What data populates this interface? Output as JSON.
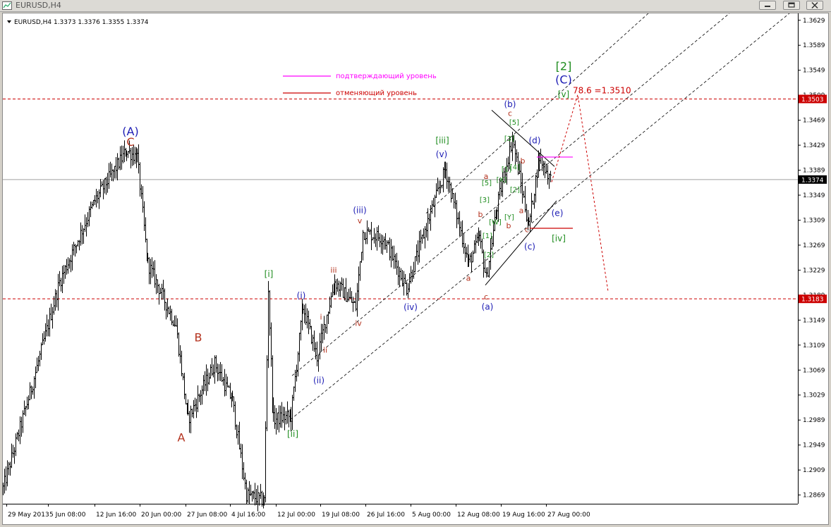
{
  "window": {
    "title": "EURUSD,H4",
    "icon": "chart-window-icon",
    "controls": [
      "minimize-icon",
      "restore-icon",
      "close-icon"
    ]
  },
  "header": {
    "symbol_line": "EURUSD,H4  1.3373 1.3376 1.3355 1.3374"
  },
  "legend": [
    {
      "label": "подтверждающий уровень",
      "color": "#ff00ff"
    },
    {
      "label": "отменяющий уровень",
      "color": "#cc0000"
    }
  ],
  "colors": {
    "background": "#ffffff",
    "bars": "#000000",
    "grid": "#c0c0c0",
    "level_line": "#cc0000",
    "channel": "#000000",
    "wave_blue": "#1c1cb4",
    "wave_green": "#1e8c1e",
    "wave_red": "#b4321e"
  },
  "chart_data": {
    "type": "ohlc",
    "symbol": "EURUSD",
    "timeframe": "H4",
    "last": {
      "open": 1.3373,
      "high": 1.3376,
      "low": 1.3355,
      "close": 1.3374
    },
    "ylim": [
      1.2855,
      1.364
    ],
    "y_ticks": [
      1.3629,
      1.3589,
      1.3549,
      1.3509,
      1.3469,
      1.3429,
      1.3389,
      1.3349,
      1.3309,
      1.3269,
      1.3229,
      1.3189,
      1.3149,
      1.3109,
      1.3069,
      1.3029,
      1.2989,
      1.2949,
      1.2909,
      1.2869
    ],
    "x_ticks": [
      "29 May 2013",
      "5 Jun 08:00",
      "12 Jun 16:00",
      "20 Jun 00:00",
      "27 Jun 08:00",
      "4 Jul 16:00",
      "12 Jul 00:00",
      "19 Jul 08:00",
      "26 Jul 16:00",
      "5 Aug 00:00",
      "12 Aug 08:00",
      "19 Aug 16:00",
      "27 Aug 00:00"
    ],
    "price_flags": [
      {
        "value": 1.3503,
        "label": "1.3503",
        "color": "#cc0000"
      },
      {
        "value": 1.3374,
        "label": "1.3374",
        "color": "#000000"
      },
      {
        "value": 1.3183,
        "label": "1.3183",
        "color": "#cc0000"
      }
    ],
    "horizontal_levels": [
      {
        "value": 1.3503,
        "style": "dashed",
        "color": "#cc0000"
      },
      {
        "value": 1.3183,
        "style": "dashed",
        "color": "#cc0000"
      },
      {
        "value": 1.3374,
        "style": "solid",
        "color": "#a0a0a0"
      }
    ],
    "fib_annotation": "78.6 =1.3510",
    "anchors": [
      {
        "t": 0,
        "p": 1.288
      },
      {
        "t": 40,
        "p": 1.304
      },
      {
        "t": 80,
        "p": 1.321
      },
      {
        "t": 130,
        "p": 1.334
      },
      {
        "t": 175,
        "p": 1.342
      },
      {
        "t": 190,
        "p": 1.341
      },
      {
        "t": 205,
        "p": 1.324
      },
      {
        "t": 245,
        "p": 1.314
      },
      {
        "t": 262,
        "p": 1.299
      },
      {
        "t": 300,
        "p": 1.308
      },
      {
        "t": 325,
        "p": 1.302
      },
      {
        "t": 345,
        "p": 1.287
      },
      {
        "t": 370,
        "p": 1.286
      },
      {
        "t": 376,
        "p": 1.32
      },
      {
        "t": 383,
        "p": 1.299
      },
      {
        "t": 408,
        "p": 1.2995
      },
      {
        "t": 425,
        "p": 1.317
      },
      {
        "t": 445,
        "p": 1.309
      },
      {
        "t": 470,
        "p": 1.321
      },
      {
        "t": 500,
        "p": 1.317
      },
      {
        "t": 510,
        "p": 1.329
      },
      {
        "t": 540,
        "p": 1.328
      },
      {
        "t": 572,
        "p": 1.32
      },
      {
        "t": 600,
        "p": 1.33
      },
      {
        "t": 627,
        "p": 1.339
      },
      {
        "t": 660,
        "p": 1.324
      },
      {
        "t": 675,
        "p": 1.328
      },
      {
        "t": 685,
        "p": 1.3215
      },
      {
        "t": 700,
        "p": 1.333
      },
      {
        "t": 722,
        "p": 1.344
      },
      {
        "t": 745,
        "p": 1.33
      },
      {
        "t": 760,
        "p": 1.341
      },
      {
        "t": 778,
        "p": 1.337
      }
    ],
    "wave_labels": [
      {
        "text": "(A)",
        "t": 181,
        "p": 1.3445,
        "color": "blue",
        "size": 16
      },
      {
        "text": "C",
        "t": 181,
        "p": 1.3428,
        "color": "red",
        "size": 16
      },
      {
        "text": "B",
        "t": 277,
        "p": 1.3115,
        "color": "red",
        "size": 16
      },
      {
        "text": "A",
        "t": 253,
        "p": 1.2955,
        "color": "red",
        "size": 16
      },
      {
        "text": "[i]",
        "t": 377,
        "p": 1.3218,
        "color": "green",
        "size": 12
      },
      {
        "text": "[ii]",
        "t": 411,
        "p": 1.2962,
        "color": "green",
        "size": 12
      },
      {
        "text": "(i)",
        "t": 423,
        "p": 1.3184,
        "color": "blue",
        "size": 12
      },
      {
        "text": "(ii)",
        "t": 448,
        "p": 1.3048,
        "color": "blue",
        "size": 12
      },
      {
        "text": "i",
        "t": 451,
        "p": 1.315,
        "color": "red",
        "size": 11
      },
      {
        "text": "ii",
        "t": 457,
        "p": 1.3097,
        "color": "red",
        "size": 11
      },
      {
        "text": "iii",
        "t": 469,
        "p": 1.3225,
        "color": "red",
        "size": 11
      },
      {
        "text": "iv",
        "t": 504,
        "p": 1.314,
        "color": "red",
        "size": 11
      },
      {
        "text": "v",
        "t": 506,
        "p": 1.3304,
        "color": "red",
        "size": 11
      },
      {
        "text": "(iii)",
        "t": 506,
        "p": 1.332,
        "color": "blue",
        "size": 12
      },
      {
        "text": "(iv)",
        "t": 578,
        "p": 1.3165,
        "color": "blue",
        "size": 12
      },
      {
        "text": "(v)",
        "t": 622,
        "p": 1.341,
        "color": "blue",
        "size": 12
      },
      {
        "text": "[iii]",
        "t": 623,
        "p": 1.3432,
        "color": "green",
        "size": 12
      },
      {
        "text": "a",
        "t": 660,
        "p": 1.3212,
        "color": "red",
        "size": 11
      },
      {
        "text": "c",
        "t": 685,
        "p": 1.3182,
        "color": "red",
        "size": 11
      },
      {
        "text": "(a)",
        "t": 687,
        "p": 1.3166,
        "color": "blue",
        "size": 12
      },
      {
        "text": "b",
        "t": 677,
        "p": 1.3314,
        "color": "red",
        "size": 11
      },
      {
        "text": "a",
        "t": 685,
        "p": 1.3375,
        "color": "red",
        "size": 11
      },
      {
        "text": "[5]",
        "t": 686,
        "p": 1.3365,
        "color": "green",
        "size": 10
      },
      {
        "text": "[3]",
        "t": 683,
        "p": 1.3338,
        "color": "green",
        "size": 10
      },
      {
        "text": "[1]",
        "t": 687,
        "p": 1.328,
        "color": "green",
        "size": 10
      },
      {
        "text": "[2]",
        "t": 689,
        "p": 1.325,
        "color": "green",
        "size": 10
      },
      {
        "text": "[W]",
        "t": 698,
        "p": 1.3302,
        "color": "green",
        "size": 10
      },
      {
        "text": "[X]",
        "t": 707,
        "p": 1.337,
        "color": "green",
        "size": 10
      },
      {
        "text": "[Y]",
        "t": 718,
        "p": 1.331,
        "color": "green",
        "size": 10
      },
      {
        "text": "b",
        "t": 717,
        "p": 1.3296,
        "color": "red",
        "size": 11
      },
      {
        "text": "(b)",
        "t": 719,
        "p": 1.349,
        "color": "blue",
        "size": 12
      },
      {
        "text": "c",
        "t": 719,
        "p": 1.3476,
        "color": "red",
        "size": 11
      },
      {
        "text": "[5]",
        "t": 725,
        "p": 1.3462,
        "color": "green",
        "size": 10
      },
      {
        "text": "[3]",
        "t": 718,
        "p": 1.3436,
        "color": "green",
        "size": 10
      },
      {
        "text": "[1]",
        "t": 714,
        "p": 1.3387,
        "color": "green",
        "size": 10
      },
      {
        "text": "[4]",
        "t": 726,
        "p": 1.339,
        "color": "green",
        "size": 10
      },
      {
        "text": "[2]",
        "t": 726,
        "p": 1.3354,
        "color": "green",
        "size": 10
      },
      {
        "text": "b",
        "t": 737,
        "p": 1.34,
        "color": "red",
        "size": 11
      },
      {
        "text": "a",
        "t": 735,
        "p": 1.332,
        "color": "red",
        "size": 11
      },
      {
        "text": "c",
        "t": 743,
        "p": 1.329,
        "color": "red",
        "size": 11
      },
      {
        "text": "(c)",
        "t": 747,
        "p": 1.3262,
        "color": "blue",
        "size": 12
      },
      {
        "text": "(d)",
        "t": 754,
        "p": 1.3432,
        "color": "blue",
        "size": 12
      },
      {
        "text": "(e)",
        "t": 786,
        "p": 1.3316,
        "color": "blue",
        "size": 12
      },
      {
        "text": "[iv]",
        "t": 788,
        "p": 1.3275,
        "color": "green",
        "size": 12
      },
      {
        "text": "[v]",
        "t": 795,
        "p": 1.3506,
        "color": "green",
        "size": 12
      },
      {
        "text": "(C)",
        "t": 795,
        "p": 1.3528,
        "color": "blue",
        "size": 16
      },
      {
        "text": "[2]",
        "t": 795,
        "p": 1.3549,
        "color": "green",
        "size": 16
      }
    ],
    "channels": [
      {
        "t1": 408,
        "p1": 1.299,
        "t2": 1115,
        "p2": 1.364,
        "style": "dashed"
      },
      {
        "t1": 410,
        "p1": 1.306,
        "t2": 1030,
        "p2": 1.364,
        "style": "dashed"
      },
      {
        "t1": 600,
        "p1": 1.332,
        "t2": 915,
        "p2": 1.364,
        "style": "dashed"
      }
    ],
    "triangle_lines": [
      {
        "t1": 684,
        "p1": 1.3205,
        "t2": 785,
        "p2": 1.334
      },
      {
        "t1": 693,
        "p1": 1.3485,
        "t2": 782,
        "p2": 1.3395
      }
    ],
    "confirm_level": {
      "t1": 757,
      "t2": 808,
      "p": 1.341
    },
    "cancel_level": {
      "t1": 747,
      "t2": 808,
      "p": 1.3296
    },
    "projection": [
      {
        "t": 778,
        "p": 1.337
      },
      {
        "t": 815,
        "p": 1.351
      },
      {
        "t": 858,
        "p": 1.3195
      }
    ],
    "grid": false
  }
}
